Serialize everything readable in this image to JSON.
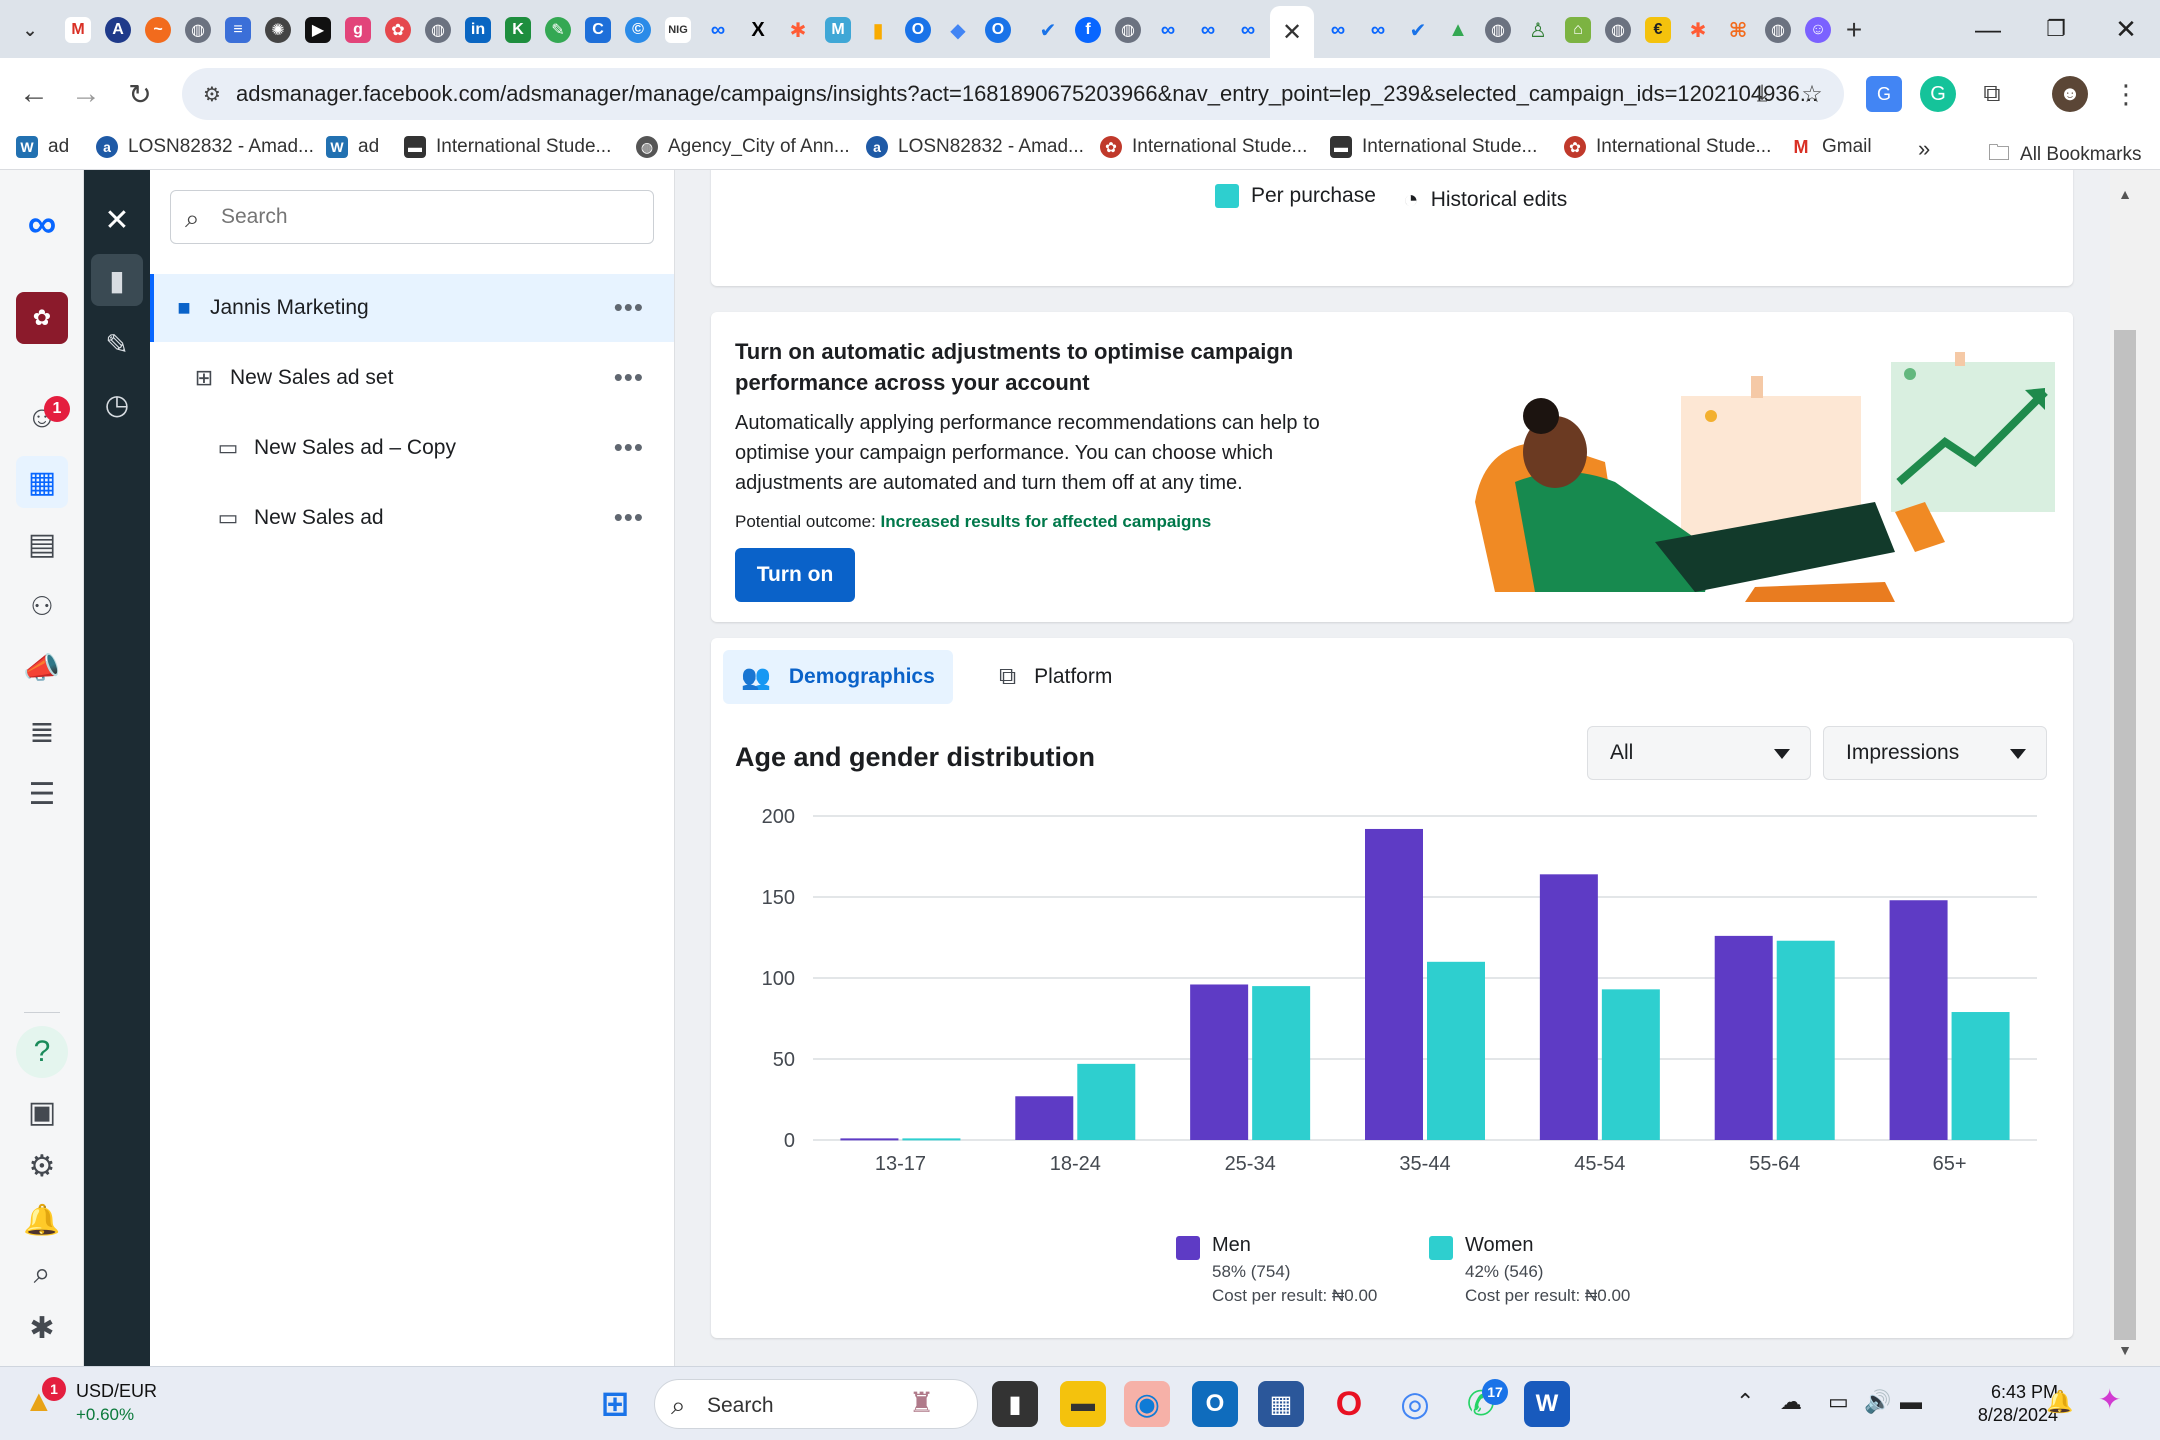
{
  "browser": {
    "url": "adsmanager.facebook.com/adsmanager/manage/campaigns/insights?act=1681890675203966&nav_entry_point=lep_239&selected_campaign_ids=1202104936...",
    "active_tab_close": "✕",
    "new_tab": "+"
  },
  "bookmarks": [
    {
      "label": "ad",
      "icon": "wordpress-icon",
      "color": "#2271b1"
    },
    {
      "label": "LOSN82832 - Amad...",
      "icon": "amadeus-icon",
      "color": "#1f5aa6"
    },
    {
      "label": "ad",
      "icon": "wordpress-icon",
      "color": "#2271b1"
    },
    {
      "label": "International Stude...",
      "icon": "page-icon",
      "color": "#333333"
    },
    {
      "label": "Agency_City of Ann...",
      "icon": "globe-icon",
      "color": "#555555"
    },
    {
      "label": "LOSN82832 - Amad...",
      "icon": "amadeus-icon",
      "color": "#1f5aa6"
    },
    {
      "label": "International Stude...",
      "icon": "flower-icon",
      "color": "#c0392b"
    },
    {
      "label": "International Stude...",
      "icon": "page-icon",
      "color": "#333333"
    },
    {
      "label": "International Stude...",
      "icon": "flower-icon",
      "color": "#c0392b"
    },
    {
      "label": "Gmail",
      "icon": "gmail-icon",
      "color": "#d93025"
    }
  ],
  "bookmarks_overflow": "»",
  "all_bookmarks": "All Bookmarks",
  "rail": {
    "notifications_badge": "1"
  },
  "tree": {
    "search_placeholder": "Search",
    "campaign": "Jannis Marketing",
    "adset": "New Sales ad set",
    "ad_copy": "New Sales ad – Copy",
    "ad": "New Sales ad",
    "more": "•••"
  },
  "top_card": {
    "per_purchase": "Per purchase",
    "historical_edits": "Historical edits"
  },
  "recommendation": {
    "title": "Turn on automatic adjustments to optimise campaign performance across your account",
    "body": "Automatically applying performance recommendations can help to optimise your campaign performance. You can choose which adjustments are automated and turn them off at any time.",
    "outcome_label": "Potential outcome:",
    "outcome_value": "Increased results for affected campaigns",
    "button": "Turn on"
  },
  "demographics": {
    "tab_demographics": "Demographics",
    "tab_platform": "Platform",
    "chart_title": "Age and gender distribution",
    "filter_value": "All",
    "metric_value": "Impressions"
  },
  "chart_data": {
    "type": "bar",
    "title": "Age and gender distribution",
    "categories": [
      "13-17",
      "18-24",
      "25-34",
      "35-44",
      "45-54",
      "55-64",
      "65+"
    ],
    "series": [
      {
        "name": "Men",
        "values": [
          1,
          27,
          96,
          192,
          164,
          126,
          148
        ],
        "color": "#5e3bc5"
      },
      {
        "name": "Women",
        "values": [
          1,
          47,
          95,
          110,
          93,
          123,
          79
        ],
        "color": "#2ecfcf"
      }
    ],
    "yticks": [
      "0",
      "50",
      "100",
      "150",
      "200"
    ],
    "ylim": [
      0,
      210
    ],
    "grid": true,
    "legend_position": "bottom"
  },
  "legend": {
    "men": {
      "name": "Men",
      "pct": "58% (754)",
      "cost": "Cost per result: ₦0.00"
    },
    "women": {
      "name": "Women",
      "pct": "42% (546)",
      "cost": "Cost per result: ₦0.00"
    }
  },
  "taskbar": {
    "ticker_name": "USD/EUR",
    "ticker_value": "+0.60%",
    "ticker_badge": "1",
    "search": "Search",
    "whatsapp_badge": "17",
    "time": "6:43 PM",
    "date": "8/28/2024"
  }
}
